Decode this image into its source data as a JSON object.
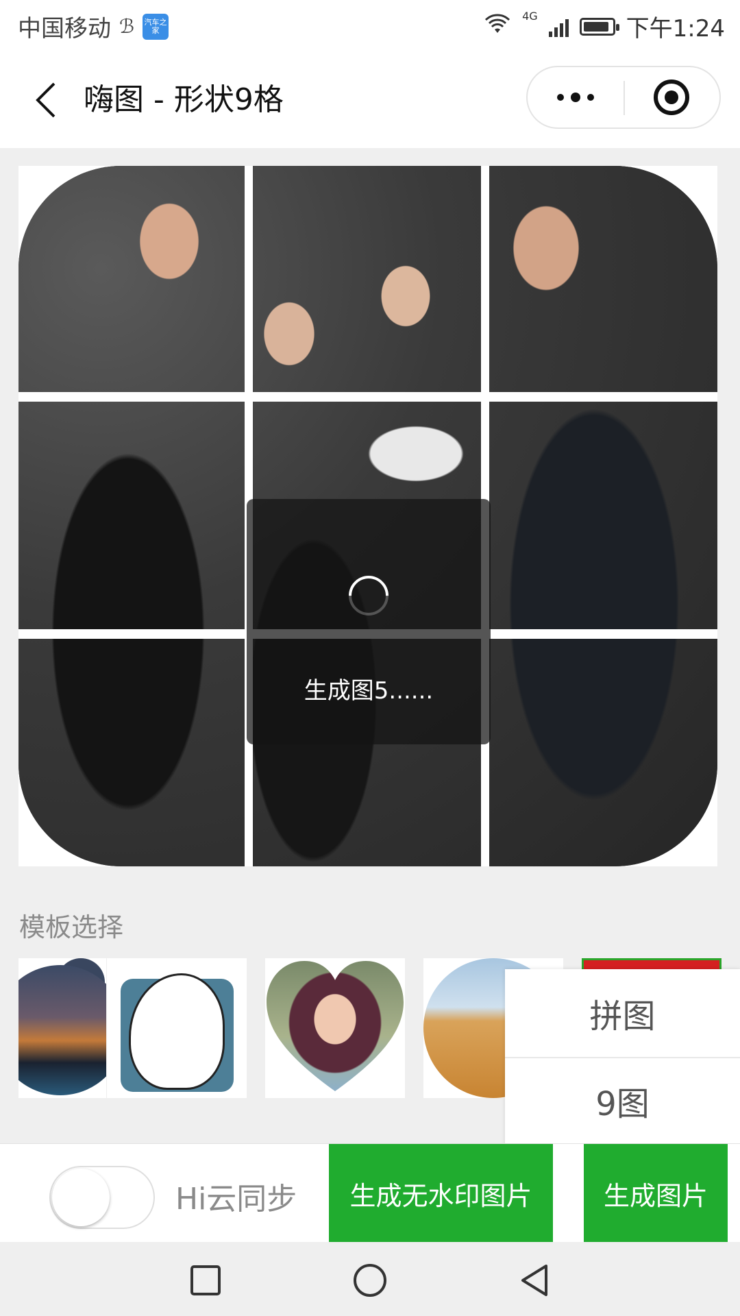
{
  "status_bar": {
    "carrier": "中国移动",
    "carrier_glyph": "ℬ",
    "app_icon_label": "汽车之家",
    "network": "4G",
    "time": "下午1:24"
  },
  "title_bar": {
    "title": "嗨图 - 形状9格",
    "icons": [
      "back-icon",
      "more-icon",
      "target-icon"
    ]
  },
  "loading": {
    "text": "生成图5......"
  },
  "templates": {
    "section_title": "模板选择",
    "items": [
      "bear-template",
      "meme-template",
      "heart-template",
      "desert-template",
      "red-template"
    ]
  },
  "popup_menu": {
    "items": [
      "拼图",
      "9图"
    ]
  },
  "action_bar": {
    "sync_label": "Hi云同步",
    "sync_enabled": false,
    "no_watermark_button": "生成无水印图片",
    "generate_button": "生成图片"
  },
  "colors": {
    "accent_green": "#20ac2f",
    "background": "#efefef"
  },
  "nav_bar": {
    "icons": [
      "square-icon",
      "circle-icon",
      "back-triangle-icon"
    ]
  }
}
